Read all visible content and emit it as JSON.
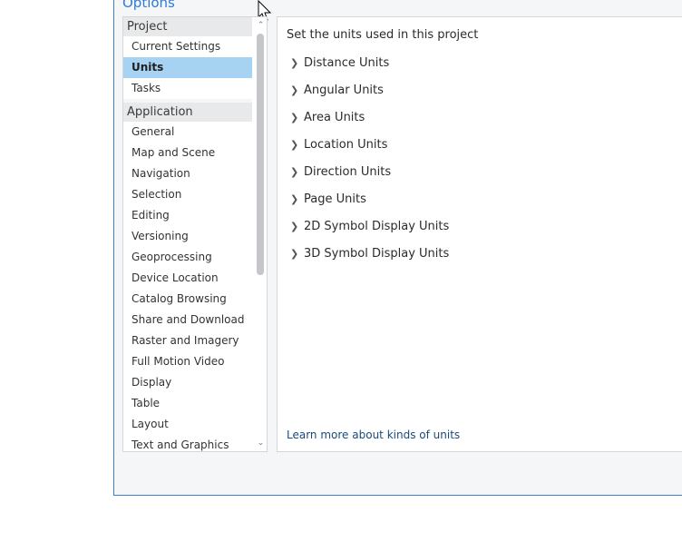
{
  "dialog": {
    "title": "Options"
  },
  "sidebar": {
    "groups": [
      {
        "label": "Project",
        "items": [
          {
            "label": "Current Settings",
            "selected": false
          },
          {
            "label": "Units",
            "selected": true
          },
          {
            "label": "Tasks",
            "selected": false
          }
        ]
      },
      {
        "label": "Application",
        "items": [
          {
            "label": "General"
          },
          {
            "label": "Map and Scene"
          },
          {
            "label": "Navigation"
          },
          {
            "label": "Selection"
          },
          {
            "label": "Editing"
          },
          {
            "label": "Versioning"
          },
          {
            "label": "Geoprocessing"
          },
          {
            "label": "Device Location"
          },
          {
            "label": "Catalog Browsing"
          },
          {
            "label": "Share and Download"
          },
          {
            "label": "Raster and Imagery"
          },
          {
            "label": "Full Motion Video"
          },
          {
            "label": "Display"
          },
          {
            "label": "Table"
          },
          {
            "label": "Layout"
          },
          {
            "label": "Text and Graphics"
          }
        ]
      }
    ]
  },
  "content": {
    "heading": "Set the units used in this project",
    "unit_sections": [
      "Distance Units",
      "Angular Units",
      "Area Units",
      "Location Units",
      "Direction Units",
      "Page Units",
      "2D Symbol Display Units",
      "3D Symbol Display Units"
    ],
    "learn_more": "Learn more about kinds of units"
  },
  "colors": {
    "accent": "#2f7bd6",
    "selection": "#a6d3f2",
    "border": "#3c7fd0"
  }
}
